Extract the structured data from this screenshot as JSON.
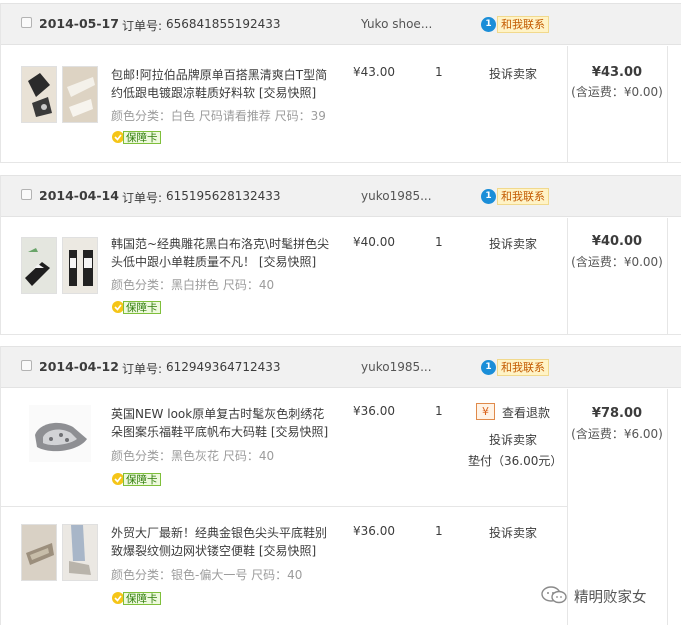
{
  "orders": [
    {
      "date": "2014-05-17",
      "order_label": "订单号:",
      "order_number": "656841855192433",
      "seller": "Yuko shoe...",
      "contact_label": "和我联系",
      "items": [
        {
          "title": "包邮!阿拉伯品牌原单百搭黑清爽白T型简约低跟电镀跟凉鞋质好料软 [交易快照]",
          "attributes": "颜色分类：白色  尺码请看推荐  尺码：39",
          "badge": "保障卡",
          "price": "¥43.00",
          "quantity": "1",
          "complain": "投诉卖家"
        }
      ],
      "total": "¥43.00",
      "shipping": "(含运费：¥0.00)"
    },
    {
      "date": "2014-04-14",
      "order_label": "订单号:",
      "order_number": "615195628132433",
      "seller": "yuko1985...",
      "contact_label": "和我联系",
      "items": [
        {
          "title": "韩国范~经典雕花黑白布洛克\\时髦拼色尖头低中跟小单鞋质量不凡！ [交易快照]",
          "attributes": "颜色分类：黑白拼色   尺码：40",
          "badge": "保障卡",
          "price": "¥40.00",
          "quantity": "1",
          "complain": "投诉卖家"
        }
      ],
      "total": "¥40.00",
      "shipping": "(含运费：¥0.00)"
    },
    {
      "date": "2014-04-12",
      "order_label": "订单号:",
      "order_number": "612949364712433",
      "seller": "yuko1985...",
      "contact_label": "和我联系",
      "items": [
        {
          "title": "英国NEW look原单复古时髦灰色刺绣花朵图案乐福鞋平底帆布大码鞋 [交易快照]",
          "attributes": "颜色分类：黑色灰花   尺码：40",
          "badge": "保障卡",
          "price": "¥36.00",
          "quantity": "1",
          "refund_icon": "¥",
          "refund": "查看退款",
          "complain": "投诉卖家",
          "advance": "垫付（36.00元）"
        },
        {
          "title": "外贸大厂最新！经典金银色尖头平底鞋别致爆裂纹侧边网状镂空便鞋 [交易快照]",
          "attributes": "颜色分类：银色-偏大一号   尺码：40",
          "badge": "保障卡",
          "price": "¥36.00",
          "quantity": "1",
          "complain": "投诉卖家"
        }
      ],
      "total": "¥78.00",
      "shipping": "(含运费：¥6.00)"
    }
  ],
  "watermark": "精明败家女",
  "colors": {
    "header_bg": "#f1f1f1",
    "contact_icon": "#1b8ed8",
    "contact_bg": "#fff3c6",
    "badge_green": "#2f7d0a",
    "refund_orange": "#d9621b"
  }
}
